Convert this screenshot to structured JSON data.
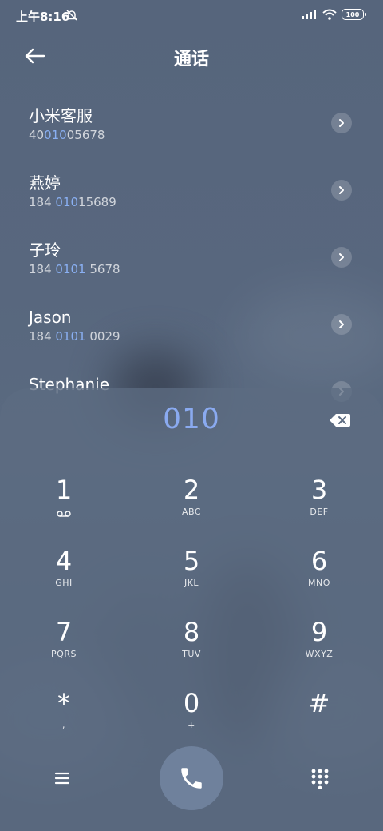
{
  "status_bar": {
    "time": "上午8:16",
    "battery": "100",
    "icons": [
      "mute-icon",
      "signal-icon",
      "wifi-icon",
      "battery-icon"
    ]
  },
  "header": {
    "title": "通话",
    "back_icon": "arrow-left-icon"
  },
  "contacts": [
    {
      "name": "小米客服",
      "number_pre": "40",
      "number_match": "010",
      "number_post": "05678"
    },
    {
      "name": "燕婷",
      "number_pre": "184 ",
      "number_match": "010",
      "number_post": "15689"
    },
    {
      "name": "子玲",
      "number_pre": "184 ",
      "number_match": "0101",
      "number_post": " 5678"
    },
    {
      "name": "Jason",
      "number_pre": "184 ",
      "number_match": "0101",
      "number_post": " 0029"
    },
    {
      "name": "Stephanie",
      "number_pre": "",
      "number_match": "",
      "number_post": ""
    }
  ],
  "dialer": {
    "input_value": "010",
    "keys": [
      {
        "digit": "1",
        "letters": ""
      },
      {
        "digit": "2",
        "letters": "ABC"
      },
      {
        "digit": "3",
        "letters": "DEF"
      },
      {
        "digit": "4",
        "letters": "GHI"
      },
      {
        "digit": "5",
        "letters": "JKL"
      },
      {
        "digit": "6",
        "letters": "MNO"
      },
      {
        "digit": "7",
        "letters": "PQRS"
      },
      {
        "digit": "8",
        "letters": "TUV"
      },
      {
        "digit": "9",
        "letters": "WXYZ"
      },
      {
        "digit": "*",
        "letters": ","
      },
      {
        "digit": "0",
        "letters": "+"
      },
      {
        "digit": "#",
        "letters": ""
      }
    ]
  },
  "colors": {
    "accent": "#8aaaf0",
    "call_button": "#6f819c"
  }
}
